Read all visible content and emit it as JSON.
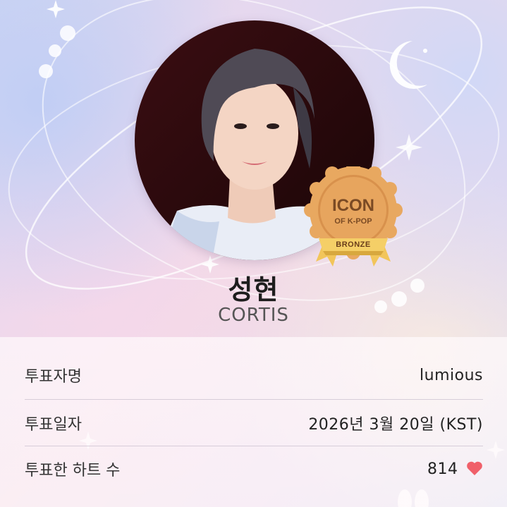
{
  "profile": {
    "name": "성현",
    "group": "CORTIS"
  },
  "badge": {
    "line1": "ICON",
    "line2": "OF K-POP",
    "ribbon": "BRONZE"
  },
  "details": [
    {
      "label": "투표자명",
      "value": "lumious"
    },
    {
      "label": "투표일자",
      "value": "2026년 3월 20일 (KST)"
    },
    {
      "label": "투표한 하트 수",
      "value": "814"
    }
  ],
  "colors": {
    "heart": "#f0606a",
    "badge_bronze": "#e0a15c",
    "ribbon": "#f2c55a"
  }
}
